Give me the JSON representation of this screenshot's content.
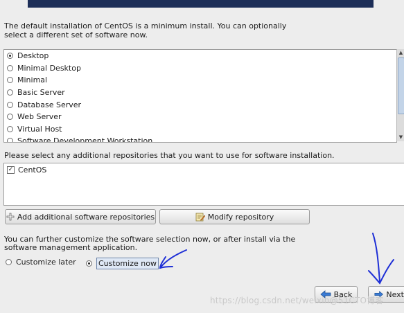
{
  "intro_text": "The default installation of CentOS is a minimum install. You can optionally select a different set of software now.",
  "software_list": {
    "items": [
      {
        "label": "Desktop",
        "selected": true
      },
      {
        "label": "Minimal Desktop",
        "selected": false
      },
      {
        "label": "Minimal",
        "selected": false
      },
      {
        "label": "Basic Server",
        "selected": false
      },
      {
        "label": "Database Server",
        "selected": false
      },
      {
        "label": "Web Server",
        "selected": false
      },
      {
        "label": "Virtual Host",
        "selected": false
      },
      {
        "label": "Software Development Workstation",
        "selected": false
      }
    ]
  },
  "repos": {
    "label": "Please select any additional repositories that you want to use for software installation.",
    "items": [
      {
        "label": "CentOS",
        "checked": true
      }
    ]
  },
  "buttons": {
    "add_repo": "Add additional software repositories",
    "modify_repo": "Modify repository",
    "back": "Back",
    "next": "Next"
  },
  "customize": {
    "text": "You can further customize the software selection now, or after install via the software management application.",
    "later": "Customize later",
    "now": "Customize now",
    "selected": "now"
  },
  "watermark": "https://blog.csdn.net/weixin@51CTO博客",
  "colors": {
    "banner": "#1d2e58",
    "annotation": "#1e2fd6",
    "background": "#ededed"
  }
}
